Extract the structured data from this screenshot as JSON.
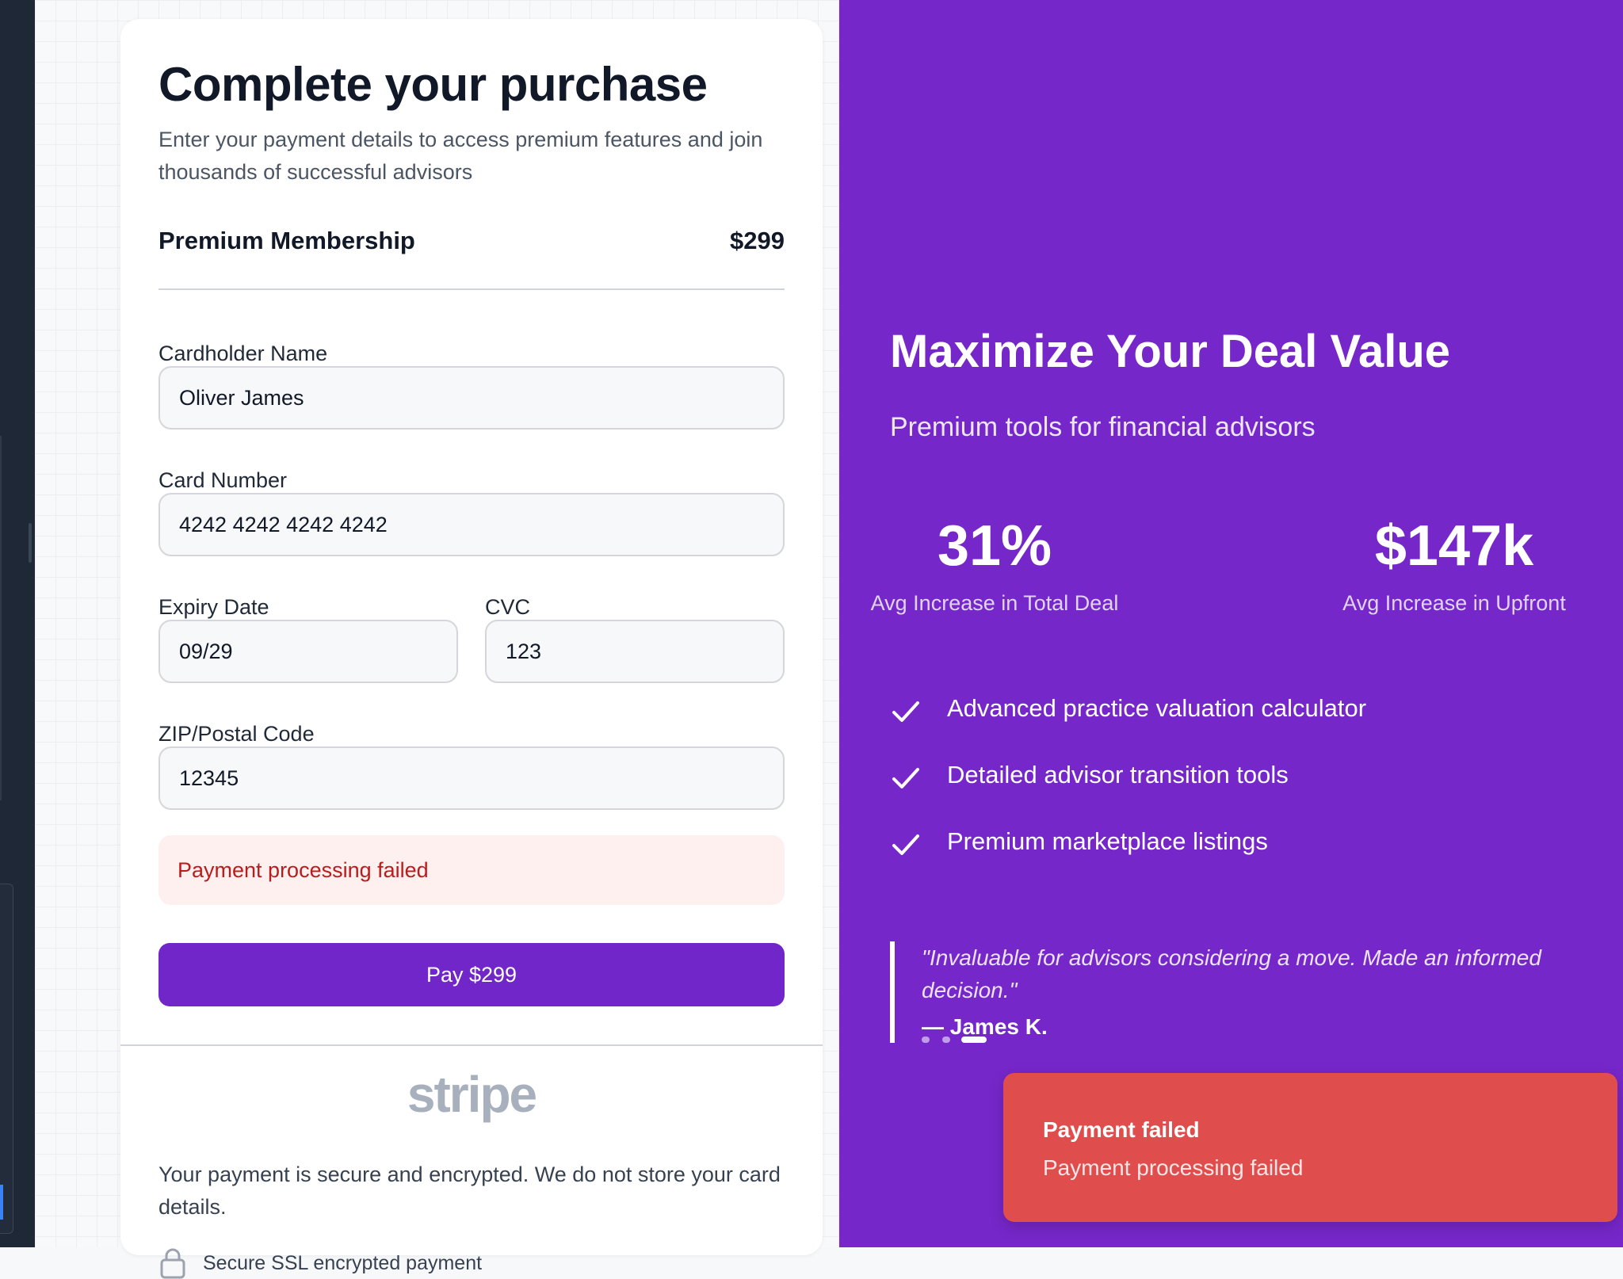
{
  "checkout": {
    "title": "Complete your purchase",
    "subtitle": "Enter your payment details to access premium features and join thousands of successful advisors",
    "plan": {
      "name": "Premium Membership",
      "price": "$299"
    },
    "fields": {
      "cardholder_name": {
        "label": "Cardholder Name",
        "value": "Oliver James"
      },
      "card_number": {
        "label": "Card Number",
        "value": "4242 4242 4242 4242"
      },
      "expiry": {
        "label": "Expiry Date",
        "value": "09/29"
      },
      "cvc": {
        "label": "CVC",
        "value": "123"
      },
      "zip": {
        "label": "ZIP/Postal Code",
        "value": "12345"
      }
    },
    "error_message": "Payment processing failed",
    "pay_button_label": "Pay $299",
    "stripe_logo": "stripe",
    "secure_note": "Your payment is secure and encrypted. We do not store your card details.",
    "ssl_note": "Secure SSL encrypted payment"
  },
  "promo": {
    "title": "Maximize Your Deal Value",
    "subtitle": "Premium tools for financial advisors",
    "stats": [
      {
        "value": "31%",
        "label": "Avg Increase in Total Deal"
      },
      {
        "value": "$147k",
        "label": "Avg Increase in Upfront"
      }
    ],
    "features": [
      "Advanced practice valuation calculator",
      "Detailed advisor transition tools",
      "Premium marketplace listings"
    ],
    "testimonial": {
      "quote": "\"Invaluable for advisors considering a move. Made an informed decision.\"",
      "author": "— James K."
    }
  },
  "toast": {
    "title": "Payment failed",
    "message": "Payment processing failed"
  },
  "colors": {
    "accent_purple": "#7627c9",
    "button_purple": "#7026c8",
    "error_red": "#e04d4d",
    "error_text": "#b91c1c"
  },
  "icons": [
    "lock-icon",
    "check-icon"
  ]
}
